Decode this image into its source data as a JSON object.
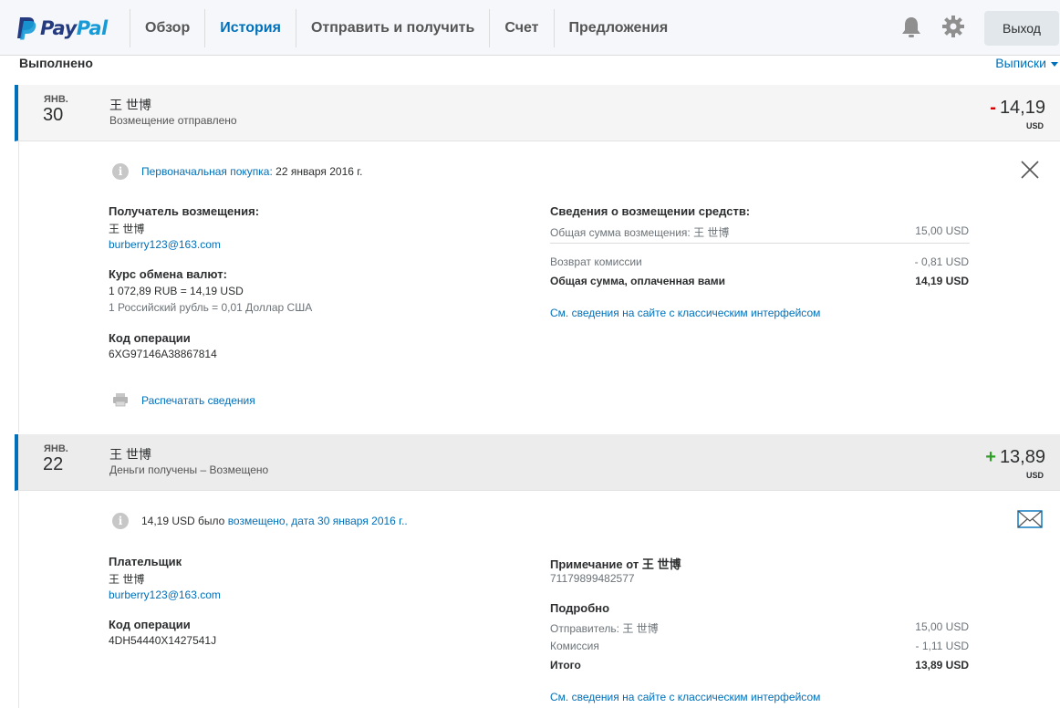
{
  "header": {
    "logo_text_1": "Pay",
    "logo_text_2": "Pal",
    "nav": [
      {
        "label": "Обзор",
        "active": false
      },
      {
        "label": "История",
        "active": true
      },
      {
        "label": "Отправить и получить",
        "active": false
      },
      {
        "label": "Счет",
        "active": false
      },
      {
        "label": "Предложения",
        "active": false
      }
    ],
    "icons": [
      "bell-icon",
      "gear-icon"
    ],
    "logout_label": "Выход"
  },
  "section": {
    "title": "Выполнено",
    "statements_label": "Выписки"
  },
  "transactions": [
    {
      "month": "ЯНВ.",
      "day": "30",
      "name": "王 世博",
      "status": "Возмещение отправлено",
      "sign": "-",
      "amount": "14,19",
      "currency": "USD",
      "notice_link": "Первоначальная покупка:",
      "notice_text": " 22 января 2016 г.",
      "recipient_label": "Получатель возмещения:",
      "recipient_name": "王 世博",
      "recipient_email": "burberry123@163.com",
      "rate_label": "Курс обмена валют:",
      "rate_line1": "1 072,89 RUB = 14,19 USD",
      "rate_line2": "1 Российский рубль = 0,01 Доллар США",
      "opcode_label": "Код операции",
      "opcode": "6XG97146A38867814",
      "print_label": "Распечатать сведения",
      "details_title": "Сведения о возмещении средств:",
      "details": [
        {
          "label": "Общая сумма возмещения: 王 世博",
          "value": "15,00 USD"
        },
        {
          "label": "Возврат комиссии",
          "value": "- 0,81 USD"
        }
      ],
      "total_label": "Общая сумма, оплаченная вами",
      "total_value": "14,19 USD",
      "classic_link": "См. сведения на сайте с классическим интерфейсом"
    },
    {
      "month": "ЯНВ.",
      "day": "22",
      "name": "王 世博",
      "status": "Деньги получены – Возмещено",
      "sign": "+",
      "amount": "13,89",
      "currency": "USD",
      "notice_text": "14,19 USD было ",
      "notice_link": "возмещено, дата 30 января 2016 г..",
      "payer_label": "Плательщик",
      "payer_name": "王 世博",
      "payer_email": "burberry123@163.com",
      "opcode_label": "Код операции",
      "opcode": "4DH54440X1427541J",
      "note_label": "Примечание от 王 世博",
      "note_text": "71179899482577",
      "details_title": "Подробно",
      "details": [
        {
          "label": "Отправитель: 王 世博",
          "value": "15,00 USD"
        },
        {
          "label": "Комиссия",
          "value": "- 1,11 USD"
        }
      ],
      "total_label": "Итого",
      "total_value": "13,89 USD",
      "classic_link": "См. сведения на сайте с классическим интерфейсом"
    }
  ]
}
